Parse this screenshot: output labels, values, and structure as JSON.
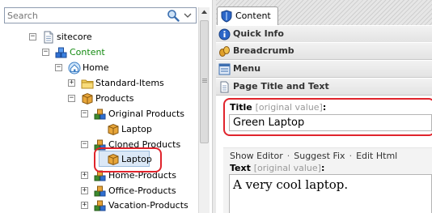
{
  "search": {
    "placeholder": "Search"
  },
  "tree": {
    "items": [
      {
        "label": "sitecore",
        "expander": "−",
        "green": false
      },
      {
        "label": "Content",
        "expander": "−",
        "green": true
      },
      {
        "label": "Home",
        "expander": "−",
        "green": false
      },
      {
        "label": "Standard-Items",
        "expander": "+",
        "green": false
      },
      {
        "label": "Products",
        "expander": "−",
        "green": false
      },
      {
        "label": "Original Products",
        "expander": "−",
        "green": false
      },
      {
        "label": "Laptop",
        "expander": "",
        "green": false
      },
      {
        "label": "Cloned Products",
        "expander": "−",
        "green": false
      },
      {
        "label": "Laptop",
        "expander": "",
        "green": false,
        "selected": true
      },
      {
        "label": "Home-Products",
        "expander": "+",
        "green": false
      },
      {
        "label": "Office-Products",
        "expander": "+",
        "green": false
      },
      {
        "label": "Vacation-Products",
        "expander": "+",
        "green": false
      }
    ]
  },
  "editor": {
    "tab_label": "Content",
    "sections": [
      {
        "label": "Quick Info",
        "icon": "info-icon"
      },
      {
        "label": "Breadcrumb",
        "icon": "breadcrumb-icon"
      },
      {
        "label": "Menu",
        "icon": "menu-icon"
      },
      {
        "label": "Page Title and Text",
        "icon": "page-icon"
      }
    ],
    "title_field": {
      "label": "Title",
      "hint": "[original value]",
      "suffix": ":",
      "value": "Green Laptop"
    },
    "links": [
      "Show Editor",
      "Suggest Fix",
      "Edit Html"
    ],
    "text_field": {
      "label": "Text",
      "hint": "[original value]",
      "suffix": ":",
      "value": "A very cool laptop."
    }
  },
  "colors": {
    "highlight": "#e0242c",
    "content_green": "#138a10",
    "selection": "#dbe8f7"
  }
}
